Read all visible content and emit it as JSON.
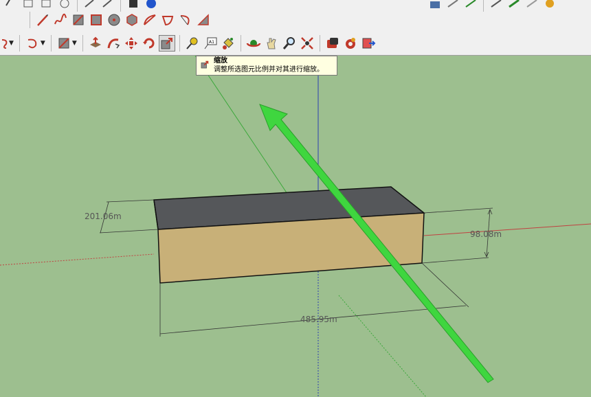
{
  "tooltip": {
    "title": "缩放",
    "description": "调整所选图元比例并对其进行缩放。"
  },
  "dimensions": {
    "height_label": "201.06m",
    "depth_label": "98.08m",
    "length_label": "485.95m"
  },
  "toolbar": {
    "active_tool": "scale",
    "row1_icons": [
      "line-icon",
      "freehand-icon",
      "rectangle-icon",
      "rotated-rectangle-icon",
      "circle-icon",
      "polygon-icon",
      "arc-icon",
      "pie-icon",
      "two-point-arc-icon",
      "three-point-arc-icon"
    ],
    "row2_icons": [
      "select-arc-icon",
      "shape-dropdown-icon",
      "push-pull-icon",
      "follow-me-icon",
      "move-icon",
      "rotate-icon",
      "scale-icon",
      "tape-measure-icon",
      "text-icon",
      "paint-bucket-icon",
      "orbit-icon",
      "pan-icon",
      "zoom-icon",
      "zoom-extents-icon",
      "warehouse-icon",
      "extension-icon",
      "send-icon"
    ]
  },
  "colors": {
    "background": "#9dbf8f",
    "box_top": "#55575a",
    "box_front": "#c8b078",
    "arrow": "#3fd63f"
  }
}
